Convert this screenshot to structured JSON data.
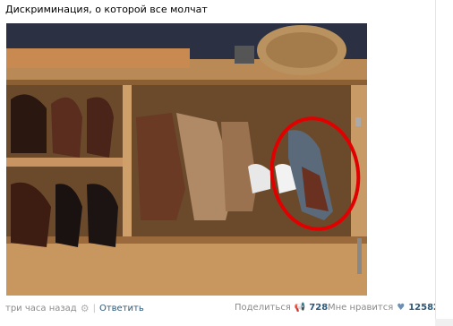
{
  "post": {
    "caption": "Дискриминация, о которой все молчат",
    "time": "три часа назад",
    "reply": "Ответить",
    "share_label": "Поделиться",
    "share_count": "728",
    "like_label": "Мне нравится",
    "like_count": "12582"
  },
  "icons": {
    "gear": "gear-icon",
    "megaphone": "megaphone-icon",
    "heart": "heart-icon"
  },
  "colors": {
    "link": "#2b587a",
    "meta": "#8a8a8a",
    "circle": "#e00000"
  }
}
